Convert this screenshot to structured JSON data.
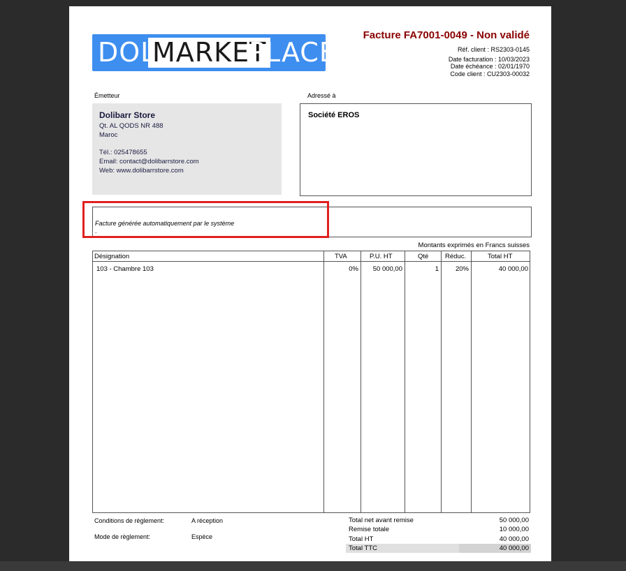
{
  "logo": {
    "part1": "DOLI",
    "part2": "MARKET",
    "part3": "PLACE"
  },
  "invoice": {
    "title": "Facture FA7001-0049 - Non validé",
    "ref_client": "Réf. client : RS2303-0145",
    "date_facturation": "Date facturation : 10/03/2023",
    "date_echeance": "Date échéance : 02/01/1970",
    "code_client": "Code client : CU2303-00032"
  },
  "sender": {
    "label": "Émetteur",
    "name": "Dolibarr Store",
    "address1": "Qt. AL QODS NR 488",
    "country": "Maroc",
    "phone": "Tél.: 025478655",
    "email": "Email: contact@dolibarrstore.com",
    "web": "Web: www.dolibarrstore.com"
  },
  "recipient": {
    "label": "Adressé à",
    "name": "Société EROS"
  },
  "note": {
    "text": "Facture générée automatiquement par le système",
    "dot": "."
  },
  "currency_note": "Montants exprimés en Francs suisses",
  "table": {
    "headers": {
      "designation": "Désignation",
      "tva": "TVA",
      "pu": "P.U. HT",
      "qty": "Qté",
      "reduc": "Réduc.",
      "total": "Total HT"
    },
    "rows": [
      {
        "designation": "103 - Chambre 103",
        "tva": "0%",
        "pu": "50 000,00",
        "qty": "1",
        "reduc": "20%",
        "total": "40 000,00"
      }
    ]
  },
  "terms": {
    "conditions_label": "Conditions de règlement:",
    "conditions_value": "A réception",
    "mode_label": "Mode de règlement:",
    "mode_value": "Espèce"
  },
  "totals": {
    "net_label": "Total net avant remise",
    "net_value": "50 000,00",
    "remise_label": "Remise totale",
    "remise_value": "10 000,00",
    "ht_label": "Total HT",
    "ht_value": "40 000,00",
    "ttc_label": "Total TTC",
    "ttc_value": "40 000,00"
  },
  "colors": {
    "title": "#8a0000",
    "logo_bg": "#3e8ef0",
    "highlight": "#e02020"
  }
}
